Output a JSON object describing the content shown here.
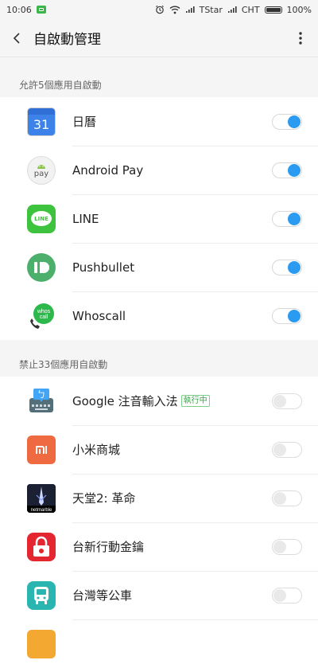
{
  "status_bar": {
    "time": "10:06",
    "carrier1": "TStar",
    "carrier2": "CHT",
    "battery": "100%"
  },
  "app_bar": {
    "title": "自啟動管理"
  },
  "allowed_section": {
    "header": "允許5個應用自啟動",
    "apps": [
      {
        "name": "日曆",
        "icon": "calendar-icon",
        "calendar_day": "31",
        "enabled": true
      },
      {
        "name": "Android Pay",
        "icon": "android-pay-icon",
        "icon_text": "pay",
        "enabled": true
      },
      {
        "name": "LINE",
        "icon": "line-icon",
        "icon_text": "LINE",
        "enabled": true
      },
      {
        "name": "Pushbullet",
        "icon": "pushbullet-icon",
        "enabled": true
      },
      {
        "name": "Whoscall",
        "icon": "whoscall-icon",
        "icon_text": "whos call",
        "enabled": true
      }
    ]
  },
  "blocked_section": {
    "header": "禁止33個應用自啟動",
    "apps": [
      {
        "name": "Google 注音輸入法",
        "tag": "執行中",
        "icon": "google-zhuyin-icon",
        "icon_text": "ㄅ",
        "enabled": false
      },
      {
        "name": "小米商城",
        "icon": "mi-store-icon",
        "icon_text": "MI",
        "enabled": false
      },
      {
        "name": "天堂2: 革命",
        "icon": "lineage2-icon",
        "icon_text": "netmarble",
        "enabled": false
      },
      {
        "name": "台新行動金鑰",
        "icon": "taishin-lock-icon",
        "enabled": false
      },
      {
        "name": "台灣等公車",
        "icon": "bus-icon",
        "enabled": false
      }
    ]
  },
  "colors": {
    "toggle_on": "#2a9bf0",
    "background": "#f5f5f5"
  }
}
